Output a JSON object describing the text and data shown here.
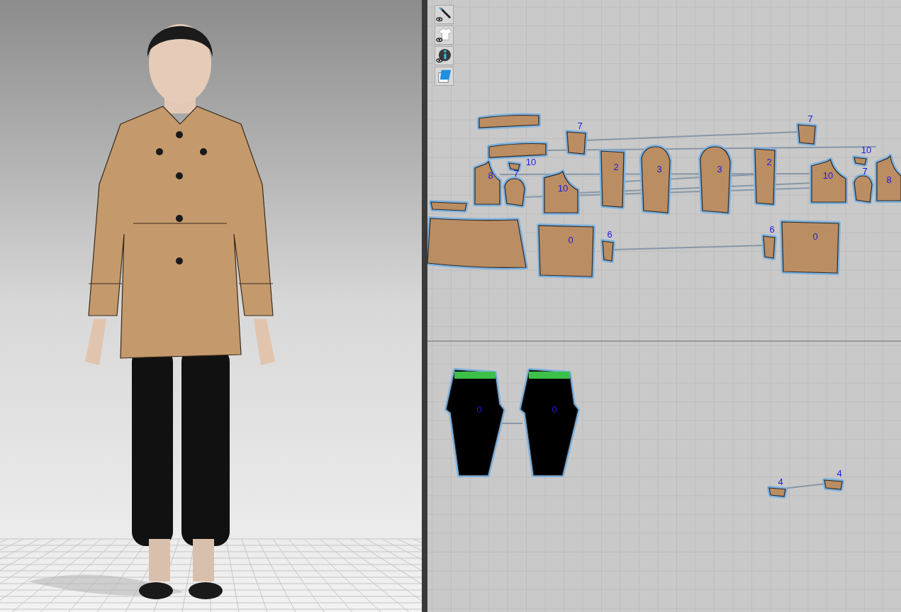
{
  "viewport_3d": {
    "floor_grid": true
  },
  "pattern_toolbar": [
    {
      "kind": "needle"
    },
    {
      "kind": "garment"
    },
    {
      "kind": "info"
    },
    {
      "kind": "piece"
    }
  ],
  "pattern_pieces": [
    {
      "kind": "coat"
    },
    {
      "kind": "coat",
      "label": "10"
    },
    {
      "kind": "coat",
      "label": "7"
    },
    {
      "kind": "coat",
      "label": "7"
    },
    {
      "kind": "coat",
      "label": "8"
    },
    {
      "kind": "coat"
    },
    {
      "kind": "coat",
      "label": "7"
    },
    {
      "kind": "coat",
      "label": "10"
    },
    {
      "kind": "coat",
      "label": "2"
    },
    {
      "kind": "coat",
      "label": "3"
    },
    {
      "kind": "coat",
      "label": "3"
    },
    {
      "kind": "coat",
      "label": "2"
    },
    {
      "kind": "coat",
      "label": "10"
    },
    {
      "kind": "coat",
      "label": "10"
    },
    {
      "kind": "coat",
      "label": "7"
    },
    {
      "kind": "coat",
      "label": "8"
    },
    {
      "kind": "coat"
    },
    {
      "kind": "coat"
    },
    {
      "kind": "coat",
      "label": "0"
    },
    {
      "kind": "coat",
      "label": "6"
    },
    {
      "kind": "coat",
      "label": "6"
    },
    {
      "kind": "coat",
      "label": "0"
    },
    {
      "kind": "pants",
      "label": "0"
    },
    {
      "kind": "pants",
      "label": "0"
    },
    {
      "kind": "coat",
      "label": "4"
    },
    {
      "kind": "coat",
      "label": "4"
    }
  ]
}
